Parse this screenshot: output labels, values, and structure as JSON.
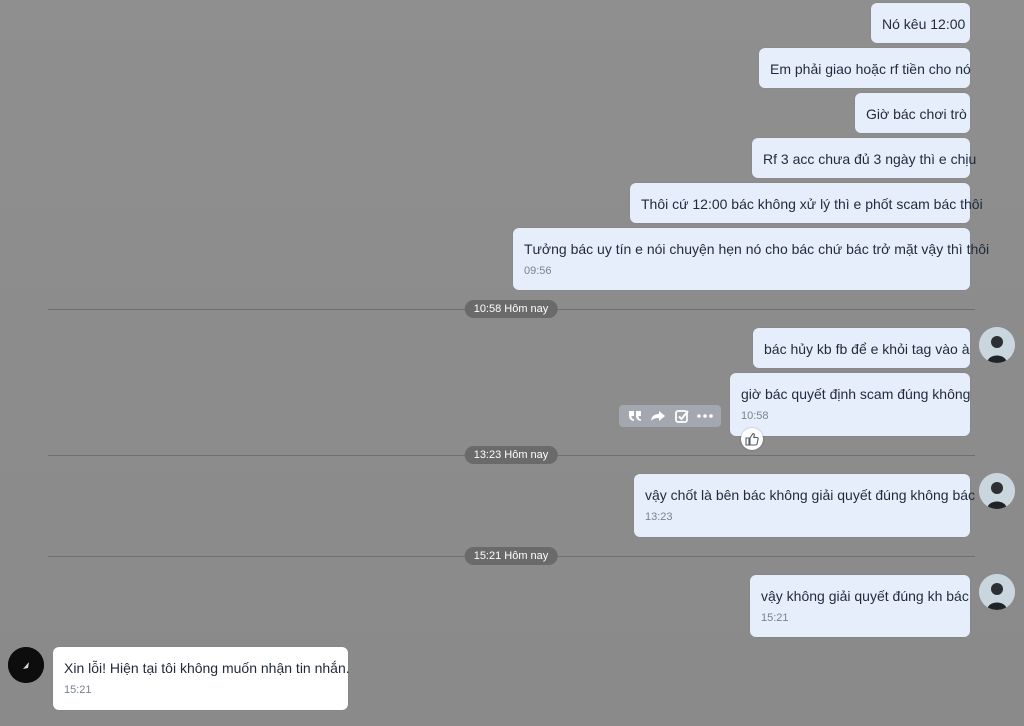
{
  "messages_top": [
    {
      "text": "Nó kêu 12:00"
    },
    {
      "text": "Em phải giao hoặc rf tiền cho nó"
    },
    {
      "text": "Giờ bác chơi trò"
    },
    {
      "text": "Rf 3 acc chưa đủ 3 ngày thì e chịu"
    },
    {
      "text": "Thôi cứ 12:00 bác không xử lý thì e phốt scam bác thôi"
    },
    {
      "text": "Tưởng bác uy tín e nói chuyện hẹn nó cho bác chứ bác trở mặt vậy thì thôi",
      "time": "09:56"
    }
  ],
  "dividers": [
    {
      "label": "10:58 Hôm nay"
    },
    {
      "label": "13:23 Hôm nay"
    },
    {
      "label": "15:21 Hôm nay"
    }
  ],
  "group_1058": [
    {
      "text": "bác hủy kb fb để e khỏi tag vào à"
    },
    {
      "text": "giờ bác quyết định scam đúng không",
      "time": "10:58"
    }
  ],
  "group_1323": [
    {
      "text": "vậy chốt là bên bác không giải quyết đúng không bác",
      "time": "13:23"
    }
  ],
  "group_1521": [
    {
      "text": "vậy không giải quyết đúng kh bác",
      "time": "15:21"
    }
  ],
  "incoming": [
    {
      "text": "Xin lỗi! Hiện tại tôi không muốn nhận tin nhắn.",
      "time": "15:21"
    }
  ],
  "icons": {
    "quote": "quote-icon",
    "forward": "forward-icon",
    "select": "select-checkbox-icon",
    "more": "more-icon",
    "like": "thumbs-up-icon"
  },
  "colors": {
    "outgoing_bubble": "#e6eefc",
    "incoming_bubble": "#ffffff",
    "background": "#8e8e8e",
    "divider_pill": "#6a6a6a"
  }
}
